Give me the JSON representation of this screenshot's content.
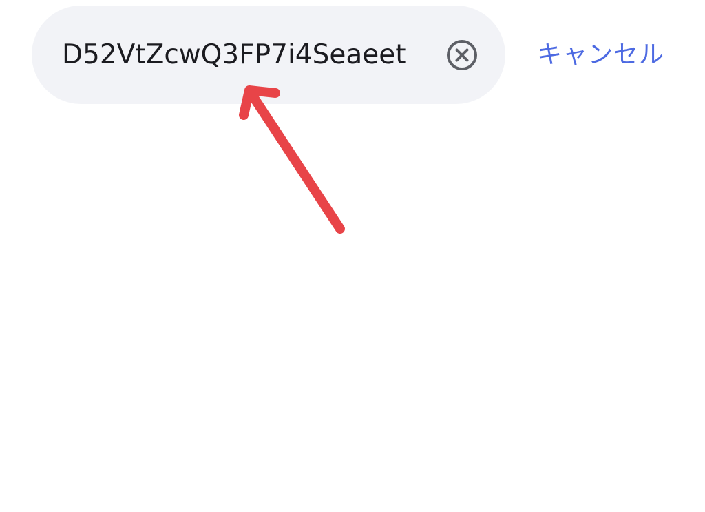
{
  "search": {
    "value": "D52VtZcwQ3FP7i4Seaeet",
    "clear_icon": "close-circle-icon",
    "cancel_label": "キャンセル"
  },
  "annotation": {
    "arrow_icon": "arrow-up-left-icon",
    "color": "#e84448"
  },
  "colors": {
    "pill_background": "#f2f3f7",
    "text": "#1b1b20",
    "icon": "#5d5f66",
    "accent": "#4d6ae2"
  }
}
